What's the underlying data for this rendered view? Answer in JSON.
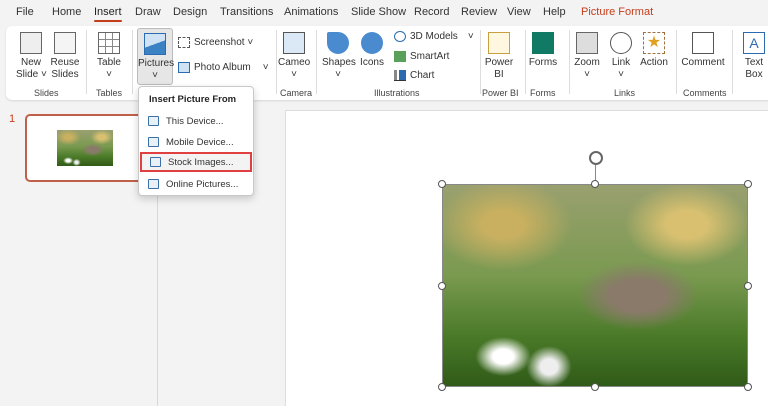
{
  "tabs": [
    "File",
    "Home",
    "Insert",
    "Draw",
    "Design",
    "Transitions",
    "Animations",
    "Slide Show",
    "Record",
    "Review",
    "View",
    "Help",
    "Picture Format"
  ],
  "ribbon": {
    "new_slide": "New\nSlide ˅",
    "reuse_slides": "Reuse\nSlides",
    "table": "Table",
    "pictures": "Pictures",
    "screenshot": "Screenshot ˅",
    "photo_album": "Photo Album",
    "cameo": "Cameo",
    "shapes": "Shapes",
    "icons": "Icons",
    "models3d": "3D Models",
    "smartart": "SmartArt",
    "chart": "Chart",
    "power_bi": "Power\nBI",
    "forms": "Forms",
    "zoom": "Zoom",
    "link": "Link",
    "action": "Action",
    "comment": "Comment",
    "text_box": "Text\nBox",
    "groups": {
      "slides": "Slides",
      "tables": "Tables",
      "camera": "Camera",
      "illustrations": "Illustrations",
      "power_bi": "Power BI",
      "forms": "Forms",
      "links": "Links",
      "comments": "Comments"
    }
  },
  "menu": {
    "header": "Insert Picture From",
    "items": [
      "This Device...",
      "Mobile Device...",
      "Stock Images...",
      "Online Pictures..."
    ],
    "selected": "Stock Images..."
  },
  "thumbs": {
    "number": "1"
  },
  "colors": {
    "accent": "#c43e1c",
    "highlight": "#e04040"
  }
}
